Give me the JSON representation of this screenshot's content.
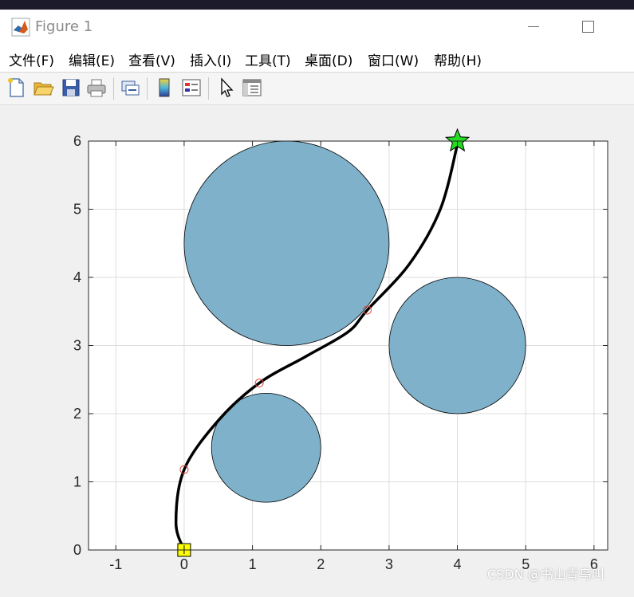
{
  "window": {
    "title": "Figure 1"
  },
  "menu": [
    {
      "label": "文件(F)"
    },
    {
      "label": "编辑(E)"
    },
    {
      "label": "查看(V)"
    },
    {
      "label": "插入(I)"
    },
    {
      "label": "工具(T)"
    },
    {
      "label": "桌面(D)"
    },
    {
      "label": "窗口(W)"
    },
    {
      "label": "帮助(H)"
    }
  ],
  "toolbar": [
    {
      "icon": "new-file-icon"
    },
    {
      "icon": "open-folder-icon"
    },
    {
      "icon": "save-icon"
    },
    {
      "icon": "print-icon"
    },
    {
      "icon": "link-figure-icon"
    },
    {
      "icon": "colorbar-icon"
    },
    {
      "icon": "legend-icon"
    },
    {
      "icon": "pointer-icon"
    },
    {
      "icon": "property-inspector-icon"
    }
  ],
  "chart_data": {
    "type": "scatter",
    "xlim": [
      -1.4,
      6.2
    ],
    "ylim": [
      0,
      6
    ],
    "x_ticks": [
      -1,
      0,
      1,
      2,
      3,
      4,
      5,
      6
    ],
    "y_ticks": [
      0,
      1,
      2,
      3,
      4,
      5,
      6
    ],
    "x_tick_labels": [
      "-1",
      "0",
      "1",
      "2",
      "3",
      "4",
      "5",
      "6"
    ],
    "y_tick_labels": [
      "0",
      "1",
      "2",
      "3",
      "4",
      "5",
      "6"
    ],
    "grid": true,
    "obstacles": [
      {
        "cx": 1.5,
        "cy": 4.5,
        "r": 1.5
      },
      {
        "cx": 4.0,
        "cy": 3.0,
        "r": 1.0
      },
      {
        "cx": 1.2,
        "cy": 1.5,
        "r": 0.8
      }
    ],
    "obstacle_color": "#7fb1cb",
    "path": [
      [
        0,
        0
      ],
      [
        -0.12,
        0.4
      ],
      [
        0.0,
        1.18
      ],
      [
        0.5,
        1.9
      ],
      [
        1.1,
        2.45
      ],
      [
        1.8,
        2.85
      ],
      [
        2.4,
        3.2
      ],
      [
        2.68,
        3.52
      ],
      [
        3.3,
        4.2
      ],
      [
        3.75,
        5.0
      ],
      [
        4.0,
        5.95
      ]
    ],
    "path_color": "#000000",
    "waypoints": [
      {
        "x": 0.0,
        "y": 1.18
      },
      {
        "x": 1.1,
        "y": 2.45
      },
      {
        "x": 2.68,
        "y": 3.52
      }
    ],
    "waypoint_color": "#e0463c",
    "start": {
      "x": 0,
      "y": 0,
      "color": "#ffff00"
    },
    "goal": {
      "x": 4,
      "y": 6,
      "color": "#22dd22"
    }
  },
  "watermark": "CSDN @书山青鸟叫"
}
